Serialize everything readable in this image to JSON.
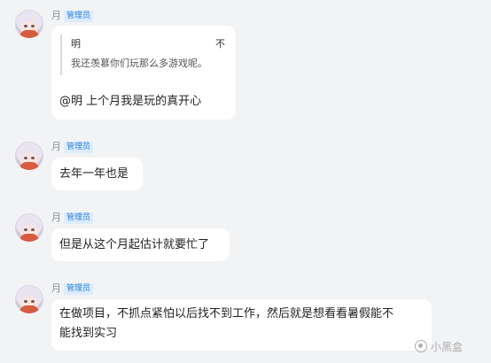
{
  "messages": [
    {
      "sender": "月",
      "badge": "管理员",
      "quote": {
        "author": "明",
        "close": "不",
        "text": "我还羡慕你们玩那么多游戏呢。"
      },
      "text": "@明 上个月我是玩的真开心"
    },
    {
      "sender": "月",
      "badge": "管理员",
      "text": "去年一年也是"
    },
    {
      "sender": "月",
      "badge": "管理员",
      "text": "但是从这个月起估计就要忙了"
    },
    {
      "sender": "月",
      "badge": "管理员",
      "text_line1": "在做项目，不抓点紧怕以后找不到工作，然后就是想看看暑假能不",
      "text_line2": "能找到实习"
    }
  ],
  "watermark": "小黑盒"
}
